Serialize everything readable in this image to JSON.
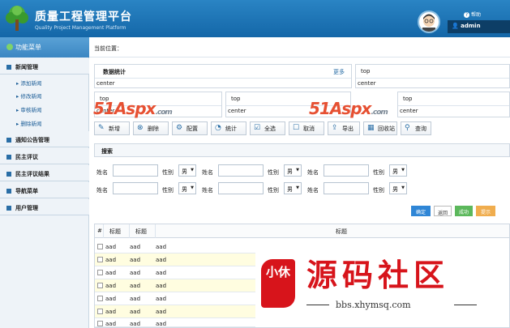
{
  "header": {
    "title": "质量工程管理平台",
    "subtitle": "Quality Project Management Platform",
    "help": "帮助",
    "username": "admin"
  },
  "sidebar": {
    "menu_title": "功能菜单",
    "groups": [
      {
        "label": "新闻管理",
        "items": [
          "添加新闻",
          "修改新闻",
          "审核新闻",
          "删除新闻"
        ]
      },
      {
        "label": "通知公告管理"
      },
      {
        "label": "民主评议"
      },
      {
        "label": "民主评议结果"
      },
      {
        "label": "导航菜单"
      },
      {
        "label": "用户管理"
      }
    ]
  },
  "breadcrumb": "当前位置：",
  "cards": [
    {
      "header": "数据统计",
      "more": "更多",
      "body": "center"
    },
    {
      "header": "top",
      "body": "center"
    },
    {
      "header": "top",
      "body": "center"
    },
    {
      "header": "top",
      "body": "center"
    },
    {
      "header": "top",
      "body": "center"
    }
  ],
  "toolbar": [
    "新增",
    "删除",
    "配置",
    "统计",
    "全选",
    "取消",
    "导出",
    "回收站",
    "查询"
  ],
  "search": {
    "title": "搜索",
    "name_label": "姓名",
    "gender_label": "性别",
    "gender_value": "男"
  },
  "actions": {
    "confirm": "确定",
    "back": "返回",
    "success": "成功",
    "warning": "提示"
  },
  "table": {
    "headers": [
      "#",
      "标题",
      "标题",
      "标题"
    ],
    "cell": "aad"
  },
  "watermarks": {
    "aspx_main": "51Aspx",
    "aspx_suffix": ".com",
    "xhy_chars": "源码社区",
    "xhy_seal": "小休",
    "xhy_url": "bbs.xhymsq.com"
  },
  "colors": {
    "header_blue": "#1467a8",
    "confirm": "#2f86d6",
    "success": "#5cb85c",
    "warning": "#f0ad4e",
    "watermark_red": "#d7141b"
  }
}
